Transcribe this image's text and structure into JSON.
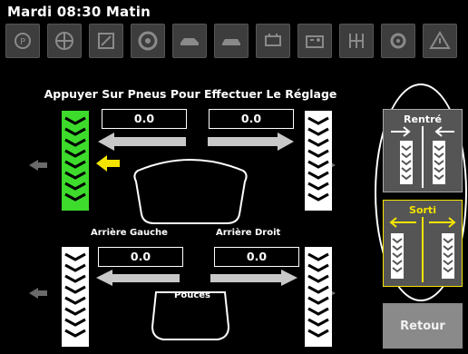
{
  "header": {
    "title": "Mardi 08:30 Matin"
  },
  "toolbar": {
    "icons": [
      "engine-warning-icon",
      "steering-wheel-icon",
      "tire-pressure-icon",
      "tire-icon",
      "car-side-icon",
      "car-front-icon",
      "engine-icon",
      "battery-icon",
      "transmission-icon",
      "settings-icon",
      "triangle-warning-icon"
    ]
  },
  "instruction": "Appuyer Sur Pneus Pour Effectuer Le Réglage",
  "front": {
    "left_value": "0.0",
    "right_value": "0.0"
  },
  "rear": {
    "left_label": "Arrière Gauche",
    "right_label": "Arrière Droit",
    "left_value": "0.0",
    "right_value": "0.0"
  },
  "unit_label": "Pouces",
  "side": {
    "retracted_label": "Rentré",
    "extended_label": "Sorti"
  },
  "return_label": "Retour",
  "colors": {
    "selected_tire": "#3ddc2c",
    "indicator_arrow": "#f5e400",
    "extended_highlight": "#f5e400",
    "button_gray": "#8a8a8a"
  }
}
